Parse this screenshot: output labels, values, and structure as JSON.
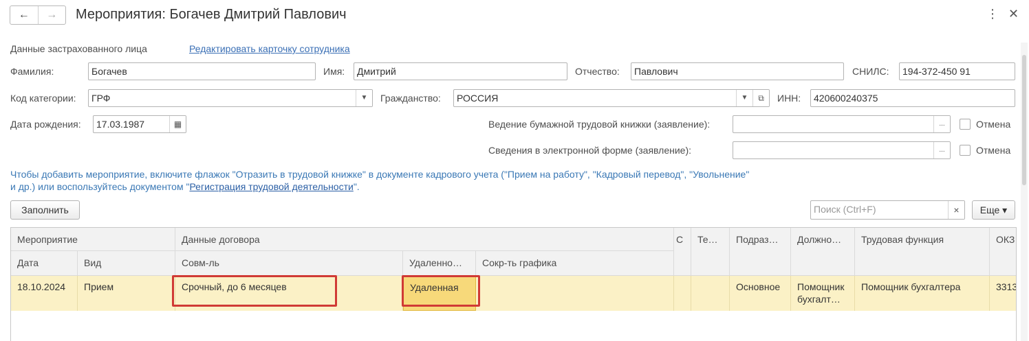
{
  "window": {
    "title": "Мероприятия: Богачев Дмитрий Павлович",
    "back_icon": "arrow-left-icon",
    "forward_icon": "arrow-right-icon",
    "menu_icon": "⋮",
    "close_icon": "✕"
  },
  "insured": {
    "section_label": "Данные застрахованного лица",
    "edit_link": "Редактировать карточку сотрудника"
  },
  "fields": {
    "surname_label": "Фамилия:",
    "surname_value": "Богачев",
    "name_label": "Имя:",
    "name_value": "Дмитрий",
    "patronymic_label": "Отчество:",
    "patronymic_value": "Павлович",
    "snils_label": "СНИЛС:",
    "snils_value": "194-372-450 91",
    "category_label": "Код категории:",
    "category_value": "ГРФ",
    "citizenship_label": "Гражданство:",
    "citizenship_value": "РОССИЯ",
    "inn_label": "ИНН:",
    "inn_value": "420600240375",
    "birth_label": "Дата рождения:",
    "birth_value": "17.03.1987",
    "paper_book_label": "Ведение бумажной трудовой книжки (заявление):",
    "paper_book_value": "",
    "electronic_label": "Сведения в электронной форме (заявление):",
    "electronic_value": "",
    "cancel_label_1": "Отмена",
    "cancel_label_2": "Отмена",
    "dots": "..."
  },
  "info": {
    "text_part1": "Чтобы добавить мероприятие, включите флажок \"Отразить в трудовой книжке\" в документе кадрового учета (\"Прием на работу\", \"Кадровый перевод\", \"Увольнение\" и др.) или воспользуйтесь документом \"",
    "link": "Регистрация трудовой деятельности",
    "text_part2": "\"."
  },
  "toolbar": {
    "fill_button": "Заполнить",
    "search_placeholder": "Поиск (Ctrl+F)",
    "clear_icon": "×",
    "more_button": "Еще ▾"
  },
  "table": {
    "headers_top": {
      "event": "Мероприятие",
      "contract": "Данные договора",
      "c": "С",
      "te": "Те…",
      "division": "Подраз…",
      "position": "Должно…",
      "function": "Трудовая функция",
      "okz": "ОКЗ"
    },
    "headers_sub": {
      "date": "Дата",
      "type": "Вид",
      "combination": "Совм-ль",
      "remote": "Удаленно…",
      "reduced": "Сокр-ть графика"
    },
    "rows": [
      {
        "date": "18.10.2024",
        "type": "Прием",
        "contract": "Срочный, до 6 месяцев",
        "remote": "Удаленная",
        "reduced": "",
        "division": "Основное",
        "position": "Помощник бухгалт…",
        "function": "Помощник бухгалтера",
        "okz": "3313"
      }
    ]
  },
  "colors": {
    "accent_link": "#3a6fb5",
    "row_highlight": "#fbf1c6",
    "annotation_red": "#d03a35"
  }
}
